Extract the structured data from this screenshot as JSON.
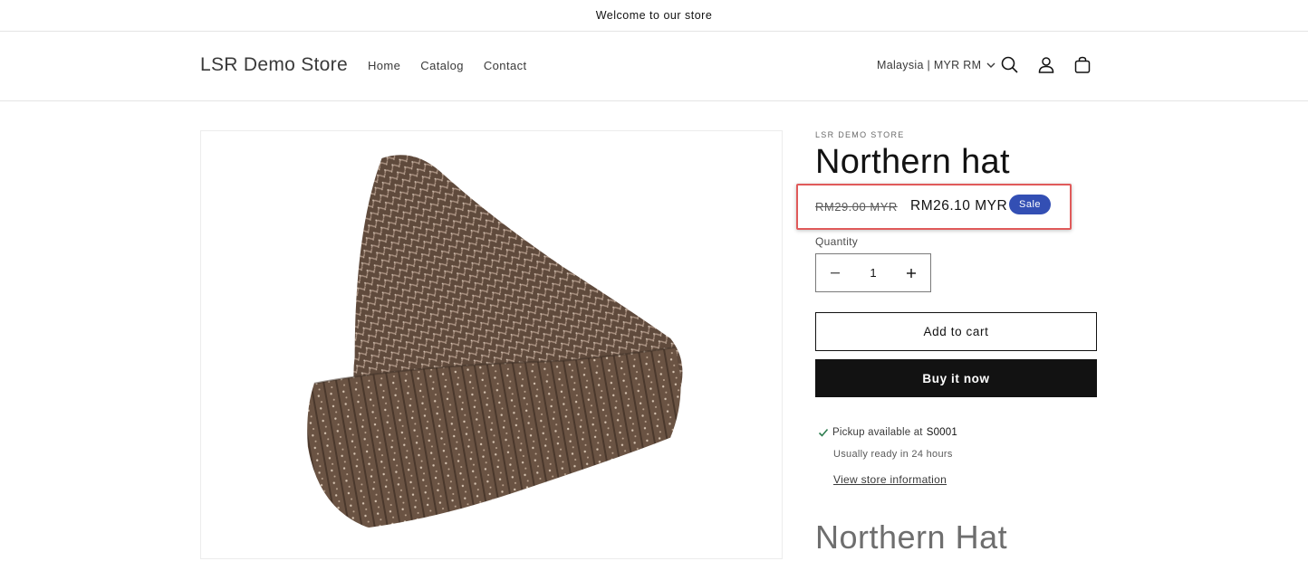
{
  "announcement": "Welcome to our store",
  "header": {
    "logo": "LSR Demo Store",
    "nav": [
      "Home",
      "Catalog",
      "Contact"
    ],
    "locale": "Malaysia | MYR RM",
    "icons": [
      "search-icon",
      "account-icon",
      "cart-icon"
    ]
  },
  "product": {
    "vendor": "LSR DEMO STORE",
    "title": "Northern hat",
    "price_regular": "RM29.00 MYR",
    "price_sale": "RM26.10 MYR",
    "badge": "Sale",
    "quantity_label": "Quantity",
    "quantity_value": "1",
    "add_to_cart": "Add to cart",
    "buy_now": "Buy it now",
    "pickup_text": "Pickup available at",
    "pickup_store": "S0001",
    "ready_text": "Usually ready in 24 hours",
    "view_store": "View store information",
    "description_title": "Northern Hat"
  },
  "colors": {
    "sale_badge": "#334fb4",
    "highlight_border": "#e05a5a",
    "primary_button": "#121212",
    "check": "#2e7d4f"
  }
}
